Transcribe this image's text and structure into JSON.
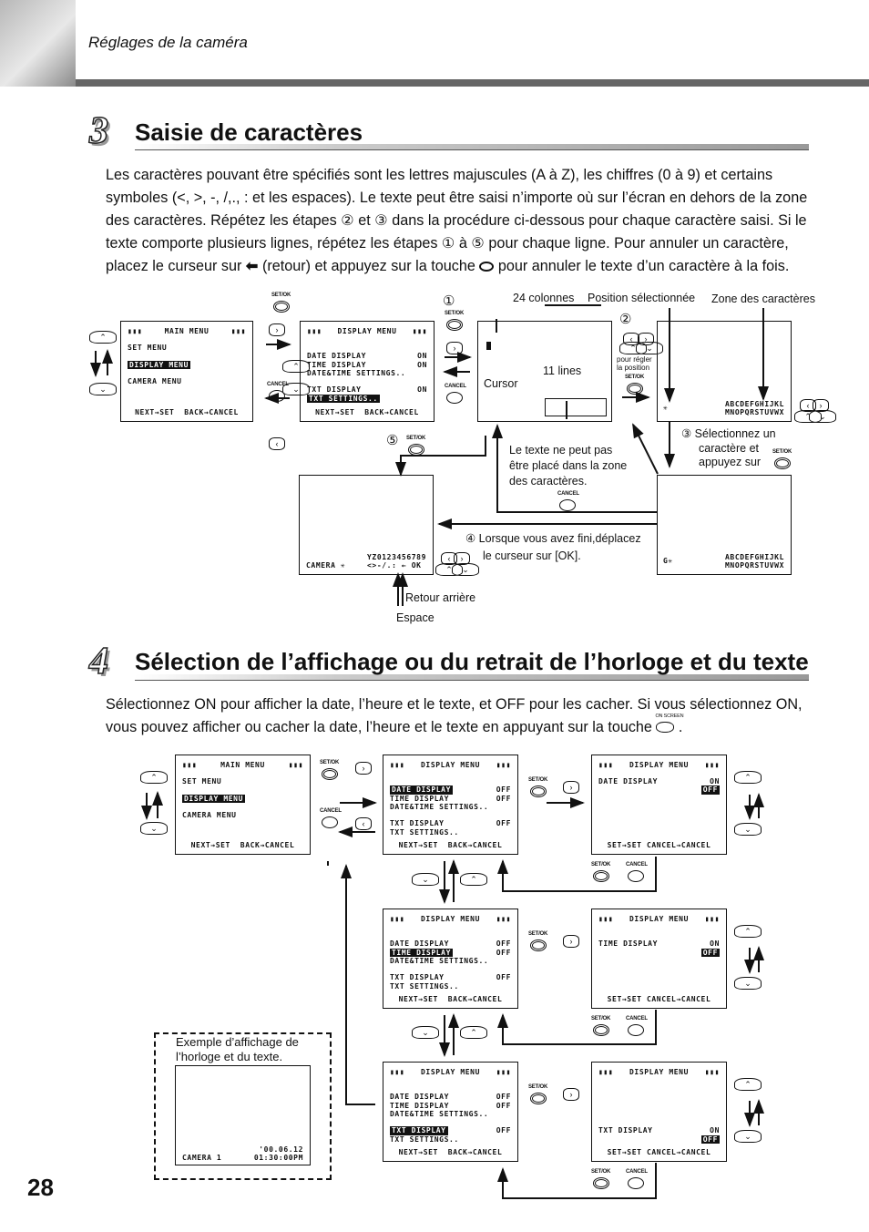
{
  "header": {
    "title": "Réglages de la caméra"
  },
  "page_number": "28",
  "buttons": {
    "set_ok": "SET/OK",
    "cancel": "CANCEL",
    "on_screen": "ON SCREEN"
  },
  "section3": {
    "number": "3",
    "title": "Saisie de caractères",
    "paragraph": "Les caractères pouvant être spécifiés sont les lettres majuscules (A à Z), les chiffres (0 à 9) et certains symboles (<, >, -, /,., : et les espaces). Le texte peut être saisi n’importe où sur l’écran en dehors de la zone des caractères. Répétez les étapes ② et ③ dans la procédure ci-dessous pour chaque caractère saisi. Si le texte comporte plusieurs lignes, répétez les étapes ① à ⑤ pour chaque ligne. Pour annuler un caractère, placez le curseur sur",
    "paragraph_mid": "(retour) et appuyez sur la touche",
    "paragraph_end": "pour annuler le texte d’un caractère à la fois.",
    "labels": {
      "step1": "①",
      "step2": "②",
      "step3": "③ Sélectionnez un",
      "step3b": "caractère et",
      "step3c": "appuyez sur",
      "step4": "④ Lorsque vous avez fini,déplacez",
      "step4b": "le curseur sur [OK].",
      "step5": "⑤",
      "columns": "24 colonnes",
      "position": "Position sélectionnée",
      "zone": "Zone des caractères",
      "lines": "11 lines",
      "cursor": "Cursor",
      "position_adjust": "pour régler",
      "position_adjust2": "la position",
      "no_text": "Le texte ne peut pas",
      "no_text2": "être placé dans la zone",
      "no_text3": "des caractères.",
      "backspace": "Retour arrière",
      "space": "Espace"
    },
    "char_rows": [
      "ABCDEFGHIJKL",
      "MNOPQRSTUVWX"
    ],
    "char_rows_2": [
      "YZ0123456789",
      "<>-/.:  ←  OK"
    ],
    "camera_label": "CAMERA",
    "selected_char": "G"
  },
  "section4": {
    "number": "4",
    "title": "Sélection de l’affichage ou du retrait de l’horloge et du texte",
    "paragraph": "Sélectionnez ON pour afficher la date, l’heure et le texte, et OFF pour les cacher. Si vous sélectionnez ON, vous pouvez afficher ou cacher la date, l’heure et le texte en appuyant sur la touche",
    "example_label": "Exemple d’affichage de l’horloge et du texte.",
    "example": {
      "date": "'00.06.12",
      "camera": "CAMERA 1",
      "time": "01:30:00PM"
    }
  },
  "screens": {
    "s_main": {
      "title": "MAIN  MENU",
      "rows": [
        {
          "l": "SET MENU"
        },
        {},
        {
          "l": "DISPLAY MENU",
          "hl": true
        },
        {},
        {
          "l": "CAMERA MENU"
        }
      ],
      "footer": "NEXT→SET  BACK→CANCEL"
    },
    "s_disp_on": {
      "title": "DISPLAY MENU",
      "rows": [
        {},
        {
          "l": "DATE DISPLAY",
          "r": "ON"
        },
        {
          "l": "TIME DISPLAY",
          "r": "ON"
        },
        {
          "l": "DATE&TIME SETTINGS.."
        },
        {},
        {
          "l": "TXT DISPLAY",
          "r": "ON"
        },
        {
          "l": "TXT SETTINGS..",
          "hl": true
        }
      ],
      "footer": "NEXT→SET  BACK→CANCEL"
    },
    "l_main": {
      "title": "MAIN  MENU",
      "rows": [
        {
          "l": "SET MENU"
        },
        {},
        {
          "l": "DISPLAY MENU",
          "hl": true
        },
        {},
        {
          "l": "CAMERA MENU"
        }
      ],
      "footer": "NEXT→SET  BACK→CANCEL"
    },
    "l_date": {
      "title": "DISPLAY MENU",
      "rows": [
        {},
        {
          "l": "DATE DISPLAY",
          "r": "OFF",
          "hl": true
        },
        {
          "l": "TIME DISPLAY",
          "r": "OFF"
        },
        {
          "l": "DATE&TIME SETTINGS.."
        },
        {},
        {
          "l": "TXT DISPLAY",
          "r": "OFF"
        },
        {
          "l": "TXT SETTINGS.."
        }
      ],
      "footer": "NEXT→SET  BACK→CANCEL"
    },
    "l_time": {
      "title": "DISPLAY MENU",
      "rows": [
        {},
        {
          "l": "DATE DISPLAY",
          "r": "OFF"
        },
        {
          "l": "TIME DISPLAY",
          "r": "OFF",
          "hl": true
        },
        {
          "l": "DATE&TIME SETTINGS.."
        },
        {},
        {
          "l": "TXT DISPLAY",
          "r": "OFF"
        },
        {
          "l": "TXT SETTINGS.."
        }
      ],
      "footer": "NEXT→SET  BACK→CANCEL"
    },
    "l_txt": {
      "title": "DISPLAY MENU",
      "rows": [
        {},
        {
          "l": "DATE DISPLAY",
          "r": "OFF"
        },
        {
          "l": "TIME DISPLAY",
          "r": "OFF"
        },
        {
          "l": "DATE&TIME SETTINGS.."
        },
        {},
        {
          "l": "TXT DISPLAY",
          "r": "OFF",
          "hl": true
        },
        {
          "l": "TXT SETTINGS.."
        }
      ],
      "footer": "NEXT→SET  BACK→CANCEL"
    },
    "r_date": {
      "title": "DISPLAY MENU",
      "rows": [
        {
          "l": "DATE DISPLAY",
          "r": "ON"
        },
        {
          "r": "OFF",
          "hlr": true
        }
      ],
      "footer": "SET→SET CANCEL→CANCEL"
    },
    "r_time": {
      "title": "DISPLAY MENU",
      "rows": [
        {},
        {
          "l": "TIME DISPLAY",
          "r": "ON"
        },
        {
          "r": "OFF",
          "hlr": true
        }
      ],
      "footer": "SET→SET CANCEL→CANCEL"
    },
    "r_txt": {
      "title": "DISPLAY MENU",
      "rows": [
        {},
        {},
        {},
        {},
        {},
        {
          "l": "TXT DISPLAY",
          "r": "ON"
        },
        {
          "r": "OFF",
          "hlr": true
        }
      ],
      "footer": "SET→SET CANCEL→CANCEL"
    }
  }
}
